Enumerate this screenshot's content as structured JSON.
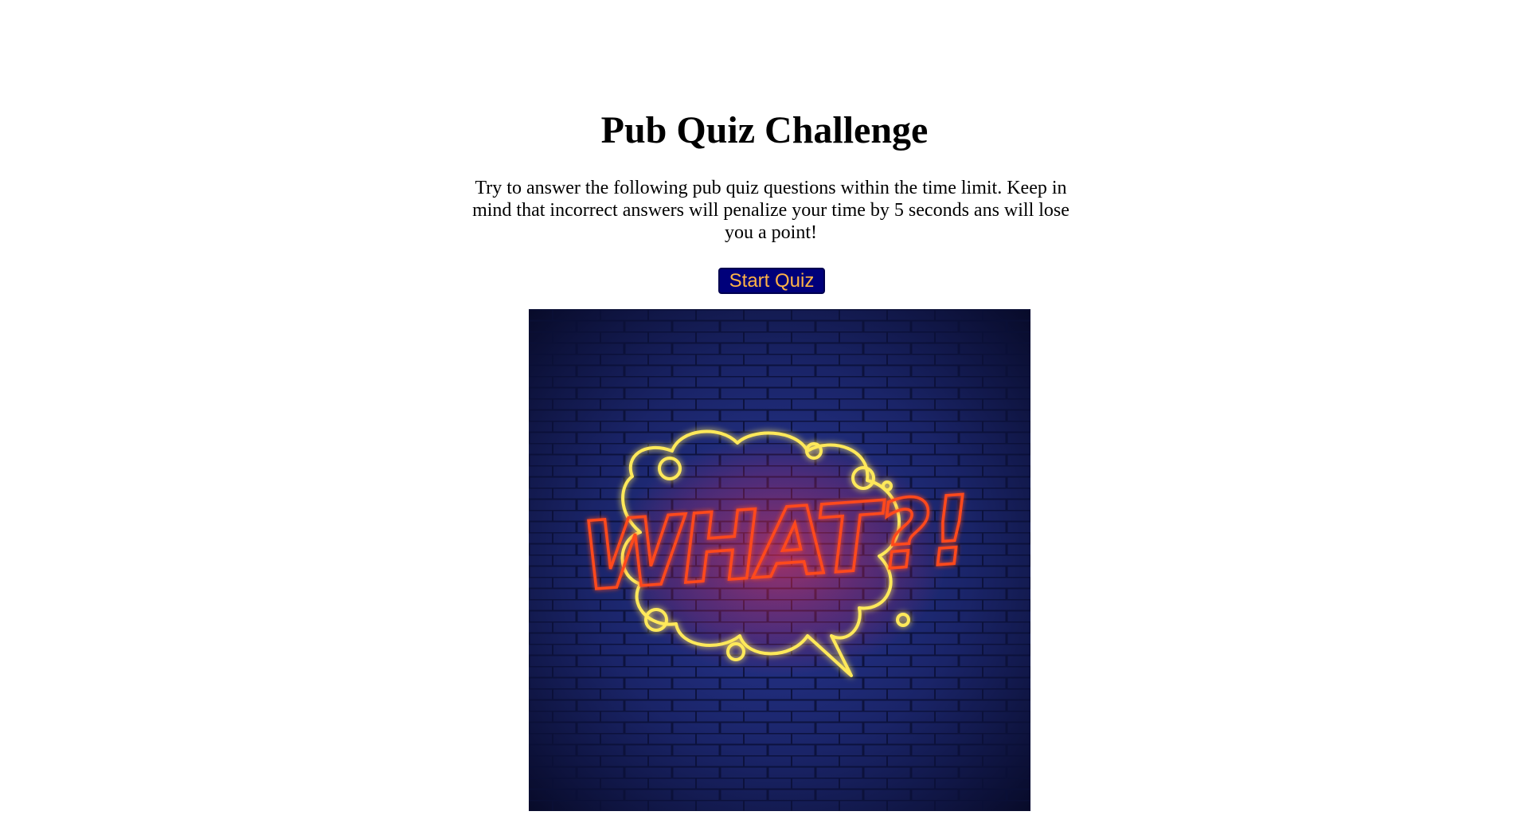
{
  "page": {
    "title": "Pub Quiz Challenge",
    "intro": "Try to answer the following pub quiz questions within the time limit. Keep in mind that incorrect answers will penalize your time by 5 seconds ans will lose you a point!",
    "start_button_label": "Start Quiz"
  },
  "hero_image": {
    "text": "WHAT?!",
    "icon": "neon-speech-bubble-icon",
    "colors": {
      "wall_dark": "#0b0f3a",
      "wall_brick": "#1e2a78",
      "bubble_neon": "#ffe95a",
      "text_neon": "#ff4a1c"
    }
  },
  "colors": {
    "button_bg": "#00007a",
    "button_text": "#ffb347",
    "page_bg": "#ffffff"
  }
}
